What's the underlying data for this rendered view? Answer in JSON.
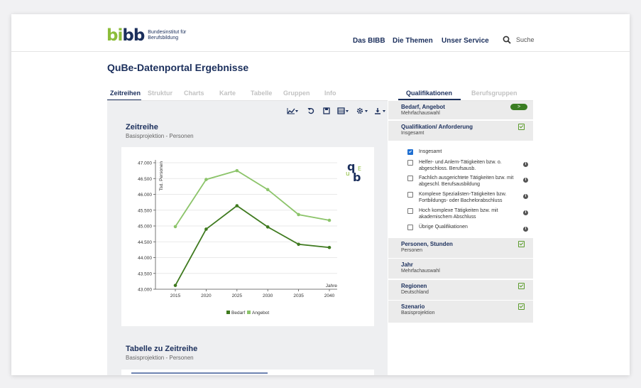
{
  "header": {
    "logo_g": "bi",
    "logo_b": "bb",
    "logo_text": "Bundesinstitut für Berufsbildung",
    "nav": [
      "Das BIBB",
      "Die Themen",
      "Unser Service"
    ],
    "search_label": "Suche"
  },
  "page": {
    "title": "QuBe-Datenportal Ergebnisse"
  },
  "tabs": [
    "Zeitreihen",
    "Struktur",
    "Charts",
    "Karte",
    "Tabelle",
    "Gruppen",
    "Info"
  ],
  "qual_tabs": [
    "Qualifikationen",
    "Berufsgruppen"
  ],
  "section1": {
    "title": "Zeitreihe",
    "subtitle": "Basisprojektion - Personen"
  },
  "section2": {
    "title": "Tabelle zu Zeitreihe",
    "subtitle": "Basisprojektion - Personen"
  },
  "chart_logo": {
    "q": "q",
    "u": "u",
    "b": "b",
    "e": "E"
  },
  "chart_data": {
    "type": "line",
    "x": [
      2015,
      2020,
      2025,
      2030,
      2035,
      2040
    ],
    "xlabel": "Jahre",
    "ylabel": "Tsd. Personen",
    "ylim": [
      43000,
      47000
    ],
    "yticks": [
      "43.000",
      "43.500",
      "44.000",
      "44.500",
      "45.000",
      "45.500",
      "46.000",
      "46.500",
      "47.000"
    ],
    "grid": true,
    "legend": "bottom",
    "series": [
      {
        "name": "Bedarf",
        "color": "#3f7a1f",
        "values": [
          43120,
          44900,
          45640,
          44970,
          44420,
          44320
        ]
      },
      {
        "name": "Angebot",
        "color": "#8cc46a",
        "values": [
          44980,
          46470,
          46750,
          46150,
          45360,
          45180
        ]
      }
    ]
  },
  "panel": {
    "groups": [
      {
        "title": "Bedarf, Angebot",
        "sub": "Mehrfachauswahl",
        "pill": ">"
      },
      {
        "title": "Qualifikation/ Anforderung",
        "sub": "Insgesamt"
      },
      {
        "title": "Personen, Stunden",
        "sub": "Personen"
      },
      {
        "title": "Jahr",
        "sub": "Mehrfachauswahl"
      },
      {
        "title": "Regionen",
        "sub": "Deutschland"
      },
      {
        "title": "Szenario",
        "sub": "Basisprojektion"
      }
    ],
    "options": [
      {
        "label": "Insgesamt",
        "checked": true
      },
      {
        "label": "Helfer- und Anlern-Tätigkeiten bzw. o. abgeschloss. Berufsausb.",
        "checked": false
      },
      {
        "label": "Fachlich ausgerichtete Tätigkeiten bzw. mit abgeschl. Berufsausbildung",
        "checked": false
      },
      {
        "label": "Komplexe Spezialisten-Tätigkeiten bzw. Fortbildungs- oder Bachelorabschluss",
        "checked": false
      },
      {
        "label": "Hoch komplexe Tätigkeiten bzw. mit akademischem Abschluss",
        "checked": false
      },
      {
        "label": "Übrige Qualifikationen",
        "checked": false
      }
    ],
    "info_glyph": "i"
  },
  "colors": {
    "primary": "#1b2f5c",
    "accent_green": "#8cbd3a",
    "dark_green": "#3a7d22",
    "panel_bg": "#ebebeb"
  }
}
